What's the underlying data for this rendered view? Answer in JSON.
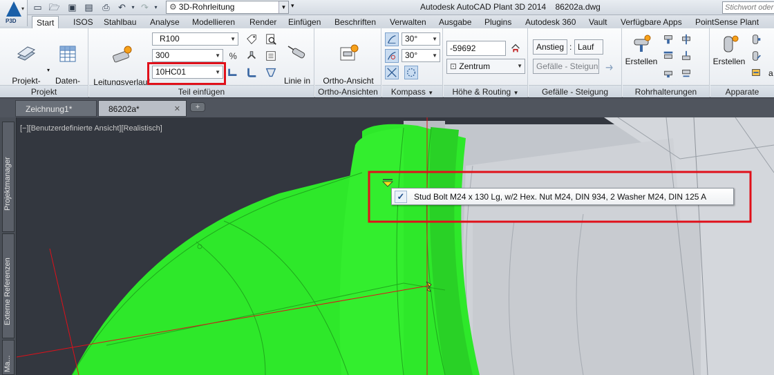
{
  "app": {
    "badge": "P3D",
    "title": "Autodesk AutoCAD Plant 3D 2014    86202a.dwg",
    "workspace": "3D-Rohrleitung",
    "search_placeholder": "Stichwort oder"
  },
  "ribbon_tabs": [
    "Start",
    "ISOS",
    "Stahlbau",
    "Analyse",
    "Modellieren",
    "Render",
    "Einfügen",
    "Beschriften",
    "Verwalten",
    "Ausgabe",
    "Plugins",
    "Autodesk 360",
    "Vault",
    "Verfügbare Apps",
    "PointSense Plant"
  ],
  "active_tab": "Start",
  "panels": {
    "projekt": {
      "title": "Projekt",
      "projektmanager": "Projekt-\nmanager",
      "datenmanager": "Daten-\nmanager"
    },
    "teil_einfuegen": {
      "title": "Teil einfügen",
      "leitungsverlauf": "Leitungsverlauf\nerstellen",
      "size_combo": "R100",
      "spec_combo": "300",
      "line_combo": "10HC01",
      "linie_in_rohr": "Linie in\nRohr"
    },
    "ortho": {
      "title": "Ortho-Ansichten",
      "ortho_ansicht": "Ortho-Ansicht\nerstellen"
    },
    "kompass": {
      "title": "Kompass",
      "angle1": "30°",
      "angle2": "30°"
    },
    "hoehe": {
      "title": "Höhe & Routing",
      "elevation": "-59692",
      "mode": "Zentrum"
    },
    "gefaelle": {
      "title": "Gefälle - Steigung",
      "anstieg": "Anstieg",
      "colon": ":",
      "lauf": "Lauf",
      "gefaelle_combo": "Gefälle - Steigun"
    },
    "rohrhalterungen": {
      "title": "Rohrhalterungen",
      "erstellen": "Erstellen"
    },
    "apparate": {
      "title": "Apparate",
      "erstellen": "Erstellen",
      "extra": "a"
    }
  },
  "document_tabs": [
    {
      "label": "Zeichnung1*",
      "active": false
    },
    {
      "label": "86202a*",
      "active": true
    }
  ],
  "palette_tabs": [
    "Projektmanager",
    "Externe Referenzen",
    "Ma..."
  ],
  "viewport": {
    "label": "[−][Benutzerdefinierte Ansicht][Realistisch]",
    "tooltip": "Stud Bolt M24 x 130 Lg,  w/2 Hex. Nut M24, DIN 934, 2 Washer M24, DIN 125 A",
    "tooltip_check": "✓"
  },
  "colors": {
    "highlight_red": "#e0101a",
    "pipe_green": "#2ee82a",
    "model_gray": "#c9ccd1",
    "viewport_bg": "#33373f"
  }
}
